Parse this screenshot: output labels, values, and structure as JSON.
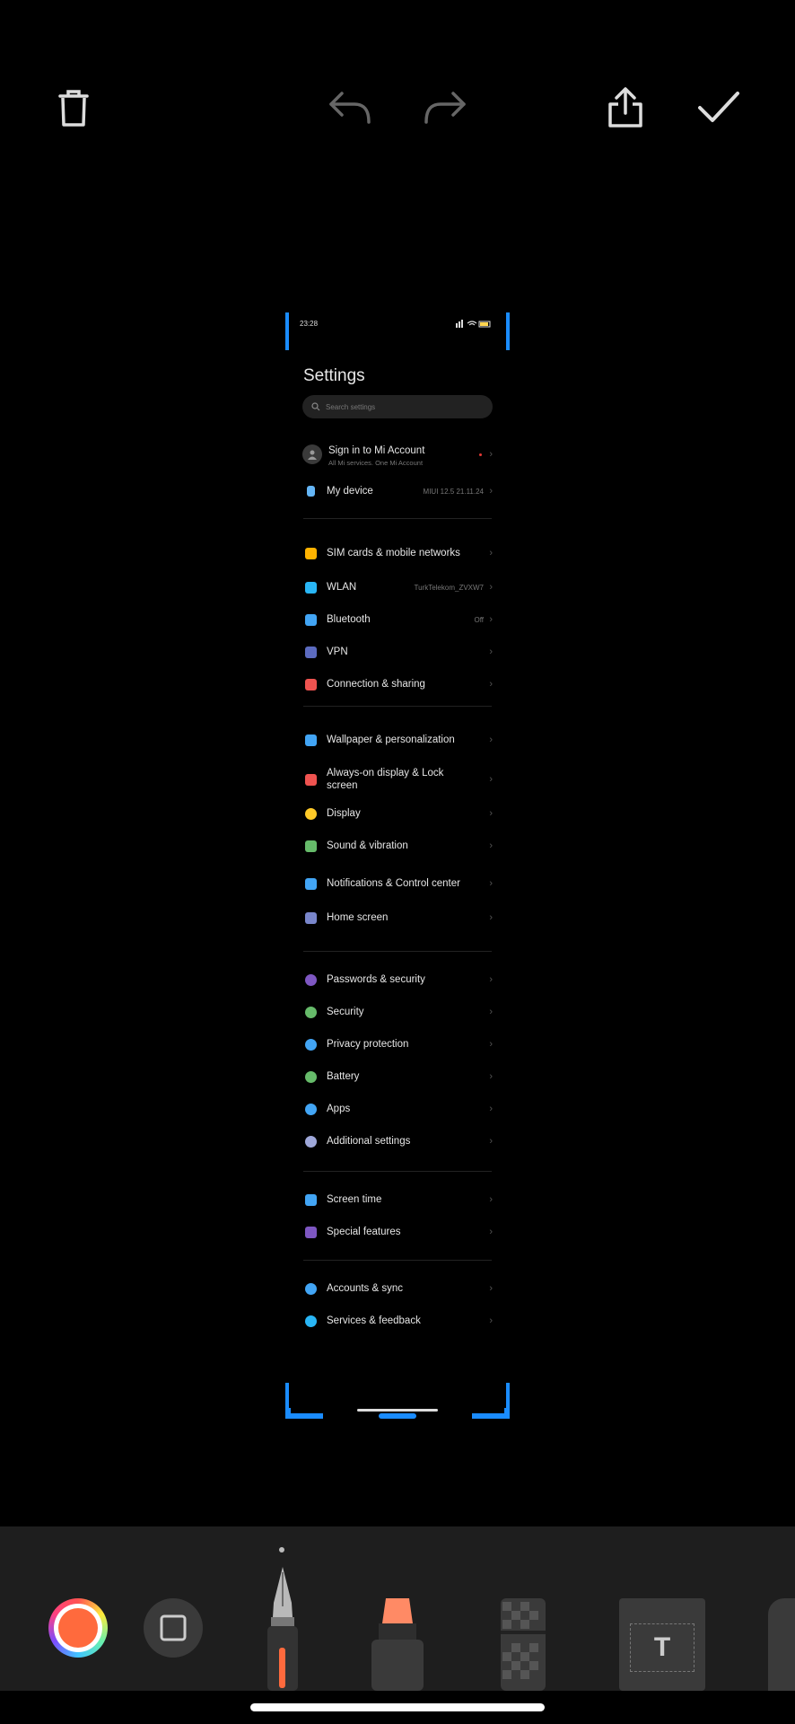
{
  "toolbar": {
    "delete_icon": "trash-icon",
    "undo_icon": "undo-icon",
    "redo_icon": "redo-icon",
    "share_icon": "share-icon",
    "done_icon": "check-icon"
  },
  "screenshot": {
    "status_time": "23:28",
    "title": "Settings",
    "search_placeholder": "Search settings",
    "account": {
      "label": "Sign in to Mi Account",
      "sub": "All Mi services. One Mi Account"
    },
    "device": {
      "label": "My device",
      "value": "MIUI 12.5 21.11.24"
    },
    "group1": [
      {
        "label": "SIM cards & mobile networks",
        "value": ""
      },
      {
        "label": "WLAN",
        "value": "TurkTelekom_ZVXW7"
      },
      {
        "label": "Bluetooth",
        "value": "Off"
      },
      {
        "label": "VPN",
        "value": ""
      },
      {
        "label": "Connection & sharing",
        "value": ""
      }
    ],
    "group2": [
      {
        "label": "Wallpaper & personalization"
      },
      {
        "label": "Always-on display & Lock screen"
      },
      {
        "label": "Display"
      },
      {
        "label": "Sound & vibration"
      },
      {
        "label": "Notifications & Control center"
      },
      {
        "label": "Home screen"
      }
    ],
    "group3": [
      {
        "label": "Passwords & security"
      },
      {
        "label": "Security"
      },
      {
        "label": "Privacy protection"
      },
      {
        "label": "Battery"
      },
      {
        "label": "Apps"
      },
      {
        "label": "Additional settings"
      }
    ],
    "group4": [
      {
        "label": "Screen time"
      },
      {
        "label": "Special features"
      }
    ],
    "group5": [
      {
        "label": "Accounts & sync"
      },
      {
        "label": "Services & feedback"
      }
    ]
  },
  "tools": {
    "text_tool_glyph": "T"
  },
  "colors": {
    "crop_accent": "#1a8cff",
    "pen_color": "#ff6a3d",
    "marker_color": "#ff8a65"
  }
}
